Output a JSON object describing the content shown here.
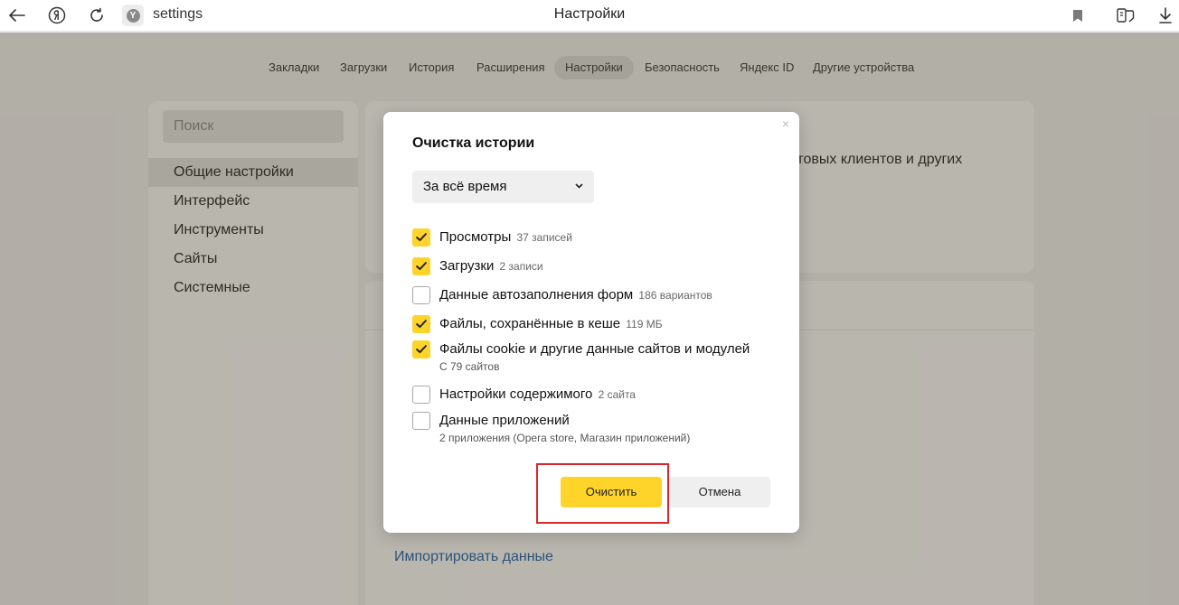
{
  "browser": {
    "address_text": "settings",
    "page_title": "Настройки",
    "icons": [
      "back-arrow-icon",
      "yandex-logo-icon",
      "reload-icon",
      "site-info-icon",
      "bookmark-icon",
      "collections-icon",
      "download-icon"
    ]
  },
  "nav": {
    "tabs": [
      {
        "label": "Закладки"
      },
      {
        "label": "Загрузки"
      },
      {
        "label": "История"
      },
      {
        "label": "Расширения"
      },
      {
        "label": "Настройки",
        "active": true
      },
      {
        "label": "Безопасность"
      },
      {
        "label": "Яндекс ID"
      },
      {
        "label": "Другие устройства"
      }
    ]
  },
  "sidebar": {
    "search_placeholder": "Поиск",
    "items": [
      {
        "label": "Общие настройки",
        "active": true
      },
      {
        "label": "Интерфейс"
      },
      {
        "label": "Инструменты"
      },
      {
        "label": "Сайты"
      },
      {
        "label": "Системные"
      }
    ]
  },
  "background": {
    "partial_text": "чтовых клиентов и других",
    "import_link": "Импортировать данные"
  },
  "dialog": {
    "title": "Очистка истории",
    "period_select": "За всё время",
    "options": [
      {
        "label": "Просмотры",
        "count": "37 записей",
        "checked": true
      },
      {
        "label": "Загрузки",
        "count": "2 записи",
        "checked": true
      },
      {
        "label": "Данные автозаполнения форм",
        "count": "186 вариантов",
        "checked": false
      },
      {
        "label": "Файлы, сохранённые в кеше",
        "count": "119 МБ",
        "checked": true
      },
      {
        "label": "Файлы cookie и другие данные сайтов и модулей",
        "sub": "С 79 сайтов",
        "checked": true
      },
      {
        "label": "Настройки содержимого",
        "count": "2 сайта",
        "checked": false
      },
      {
        "label": "Данные приложений",
        "sub": "2 приложения (Opera store, Магазин приложений)",
        "checked": false
      }
    ],
    "clear_button": "Очистить",
    "cancel_button": "Отмена",
    "close_glyph": "×"
  },
  "colors": {
    "accent_yellow": "#fed42b",
    "highlight_red": "#d9272e",
    "link_blue": "#1f5fa8"
  }
}
